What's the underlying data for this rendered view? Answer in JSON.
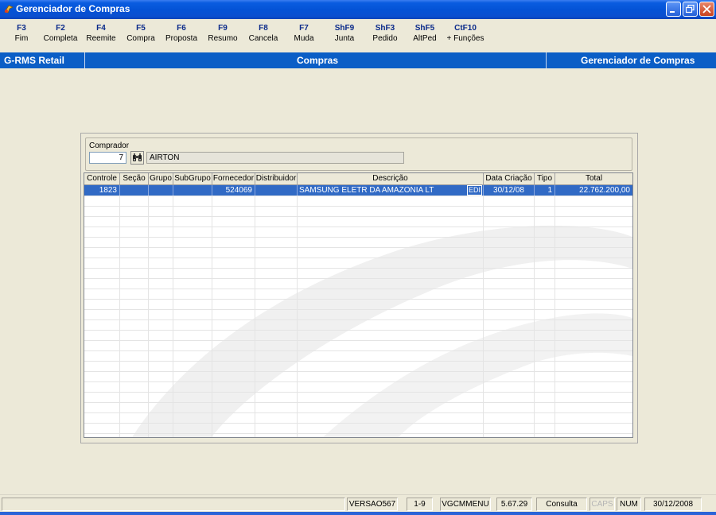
{
  "window": {
    "title": "Gerenciador de Compras"
  },
  "fkeys": [
    {
      "key": "F3",
      "label": "Fim"
    },
    {
      "key": "F2",
      "label": "Completa"
    },
    {
      "key": "F4",
      "label": "Reemite"
    },
    {
      "key": "F5",
      "label": "Compra"
    },
    {
      "key": "F6",
      "label": "Proposta"
    },
    {
      "key": "F9",
      "label": "Resumo"
    },
    {
      "key": "F8",
      "label": "Cancela"
    },
    {
      "key": "F7",
      "label": "Muda"
    },
    {
      "key": "ShF9",
      "label": "Junta"
    },
    {
      "key": "ShF3",
      "label": "Pedido"
    },
    {
      "key": "ShF5",
      "label": "AltPed"
    },
    {
      "key": "CtF10",
      "label": "+ Funções"
    }
  ],
  "band": {
    "left": "G-RMS Retail",
    "center": "Compras",
    "right": "Gerenciador de Compras"
  },
  "comprador": {
    "label": "Comprador",
    "code": "7",
    "name": "AIRTON",
    "search_icon": "binoculars-icon"
  },
  "grid": {
    "columns": [
      "Controle",
      "Seção",
      "Grupo",
      "SubGrupo",
      "Fornecedor",
      "Distribuidor",
      "Descrição",
      "Data Criação",
      "Tipo",
      "Total"
    ],
    "rows": [
      {
        "controle": "1823",
        "secao": "",
        "grupo": "",
        "subgrupo": "",
        "fornecedor": "524069",
        "distribuidor": "",
        "descricao": "SAMSUNG ELETR DA AMAZONIA LT",
        "tag": "EDI",
        "data_criacao": "30/12/08",
        "tipo": "1",
        "total": "22.762.200,00"
      }
    ]
  },
  "statusbar": {
    "empty": "",
    "versao": "VERSAO567",
    "range": "1-9",
    "menu": "VGCMMENU",
    "build": "5.67.29",
    "mode": "Consulta",
    "caps": "CAPS",
    "num": "NUM",
    "date": "30/12/2008"
  },
  "colors": {
    "titlebar": "#0453d6",
    "band": "#0b5ec6",
    "selection": "#316ac5",
    "background": "#ece9d8"
  }
}
